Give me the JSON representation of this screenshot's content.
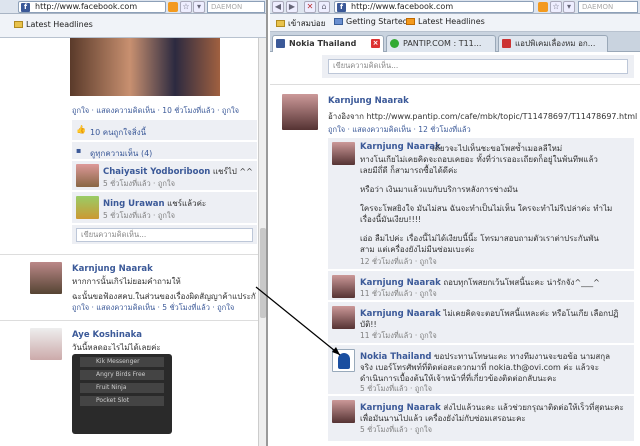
{
  "left": {
    "url": "http://www.facebook.com",
    "search": "DAEMON",
    "bookmark": "Latest Headlines",
    "actions1": "ถูกใจ · แสดงความคิดเห็น · 10 ชั่วโมงที่แล้ว · ",
    "actions1_like": "ถูกใจ",
    "likes": "10 คนถูกใจสิ่งนี้",
    "view_comments": "ดูทุกความเห็น (4)",
    "comments": [
      {
        "name": "Chaiyasit Yodboriboon",
        "text": " แชร์ไป ^^",
        "meta": "5 ชั่วโมงที่แล้ว · ถูกใจ"
      },
      {
        "name": "Ning Urawan",
        "text": " แชร์แล้วค่ะ",
        "meta": "5 ชั่วโมงที่แล้ว · ถูกใจ"
      }
    ],
    "comment_placeholder": "เขียนความคิดเห็น...",
    "post2": {
      "name": "Karnjung Naarak",
      "line1": "หากการนั้นเกิรไม่ยอมคำถามให้",
      "line2": "ฉะนั้นขอฟ้องสคบ.ในส่วนของเรื่องผิดสัญญาค้าแประกั",
      "meta": "ถูกใจ · แสดงความคิดเห็น · 5 ชั่วโมงที่แล้ว · "
    },
    "post3": {
      "name": "Aye Koshinaka",
      "line1": "วันนี้หลดอะไรไม่ได้เลยค่ะ"
    },
    "apps": [
      "Kik Messenger",
      "Angry Birds Free",
      "Fruit Ninja",
      "Pocket Slot"
    ]
  },
  "right": {
    "url": "http://www.facebook.com",
    "search": "DAEMON",
    "bookmarks": [
      "เข้าสมบ่อย",
      "Getting Started",
      "Latest Headlines"
    ],
    "tabs": [
      "Nokia Thailand",
      "PANTIP.COM : T11...",
      "แอปพิเคมเลื่องหม อก..."
    ],
    "top_input": "เขียนความคิดเห็น...",
    "post": {
      "name": "Karnjung Naarak",
      "line": "อ้างอิงจาก http://www.pantip.com/cafe/mbk/topic/T11478697/T11478697.html",
      "meta": "ถูกใจ · แสดงความคิดเห็น · 12 ชั่วโมงที่แล้ว"
    },
    "comments": [
      {
        "name": "Karnjung Naarak",
        "lines": [
          "เดียวจะไปเห็นชะขอโพสซ้ำเมอลลีใหม่",
          "ทางโนเกียไม่เคยคิดจะถอบเคยอะ ทั้งที่ว่าเรออะเถียดก็อยู่ในพ้นทีพแล้ว",
          "เลยมีถึ่ดี ก็สามารถซื้อได้ดีค่ะ",
          "",
          "หรือว่า เงินมาแล้วแบกับบริการหลังการช่างมัน",
          "",
          "ใครจะโพสยิงใจ มันไม่สน ฉันจะทำเป็นไม่เห็น ใครจะทำไม่รีเปล่าค่ะ ทำไม",
          "เรื่องนี้มันเงียบ!!!!",
          "",
          "เอ่อ ลืมไปค่ะ เรื่องนี้ไม่ได้เงียบนี้นี้ะ โทรมาสอบถามตัวเราต่าประกันพัน",
          "สาม แต่เครื่องยังไม่มีนซ่อมเบะค่ะ"
        ],
        "meta": "12 ชั่วโมงที่แล้ว · ถูกใจ"
      },
      {
        "name": "Karnjung Naarak",
        "lines": [
          " ถอบทุกโพสยกเว้นโพสนี้นะคะ น่ารักจัง^___^"
        ],
        "meta": "11 ชั่วโมงที่แล้ว · ถูกใจ"
      },
      {
        "name": "Karnjung Naarak",
        "lines": [
          " ไม่เคยคิดจะตอบโพสนี้แหละค่ะ หรือโนเกีย เลือกปฏิ",
          "บัติ!!"
        ],
        "meta": "11 ชั่วโมงที่แล้ว · ถูกใจ"
      },
      {
        "name": "Nokia Thailand",
        "lines": [
          " ขอประทานโทษนะคะ ทางทีมงานจะขอข้อ นามสกุล",
          "จริง เบอร์โทรศัพท์ที่ติดต่อสะดวกมาที่ nokia.th@ovi.com ค่ะ แล้วจะ",
          "ดำเนินการเบื้องต้นให้เจ้าหน้าที่ที่เกี่ยวข้องติดต่อกลับนะคะ"
        ],
        "meta": "5 ชั่วโมงที่แล้ว · ถูกใจ"
      },
      {
        "name": "Karnjung Naarak",
        "lines": [
          " ส่งไปแล้วนะคะ แล้วช่วยกรุณาติดต่อให้เร็วที่สุดนะคะ",
          "เพื่อมันนานไปแล้ว เครื่องยังไม่กับซ่อมเสรอนะคะ"
        ],
        "meta": "5 ชั่วโมงที่แล้ว · ถูกใจ"
      }
    ]
  }
}
